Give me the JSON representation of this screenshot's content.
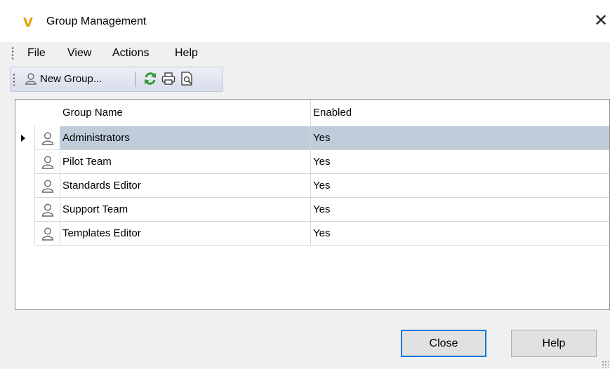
{
  "window": {
    "title": "Group Management",
    "app_icon": "V",
    "accent_color": "#e6a100"
  },
  "menu": {
    "items": [
      {
        "label": "File"
      },
      {
        "label": "View"
      },
      {
        "label": "Actions"
      },
      {
        "label": "Help"
      }
    ]
  },
  "toolbar": {
    "new_group_label": "New Group...",
    "icons": [
      "new-group-icon",
      "refresh-icon",
      "print-icon",
      "print-preview-icon"
    ]
  },
  "grid": {
    "columns": [
      {
        "label": "Group Name"
      },
      {
        "label": "Enabled"
      }
    ],
    "rows": [
      {
        "name": "Administrators",
        "enabled": "Yes"
      },
      {
        "name": "Pilot Team",
        "enabled": "Yes"
      },
      {
        "name": "Standards Editor",
        "enabled": "Yes"
      },
      {
        "name": "Support Team",
        "enabled": "Yes"
      },
      {
        "name": "Templates Editor",
        "enabled": "Yes"
      }
    ],
    "selected_row_color": "#bfcddb"
  },
  "buttons": {
    "close_label": "Close",
    "help_label": "Help",
    "focus_color": "#0078d7"
  }
}
